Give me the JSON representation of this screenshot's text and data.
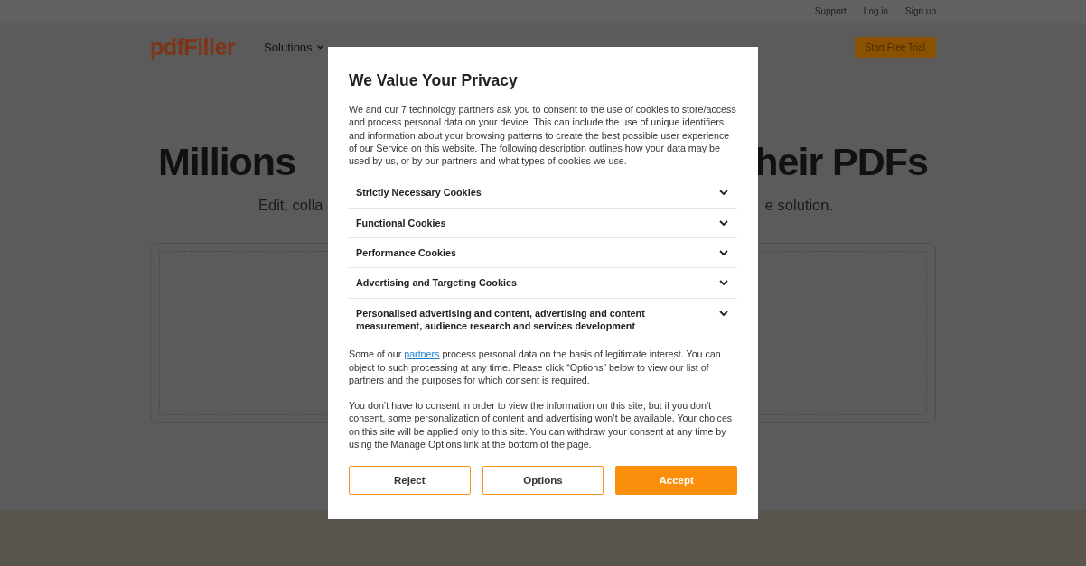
{
  "top_links": [
    "Support",
    "Log in",
    "Sign up"
  ],
  "logo": "pdfFiller",
  "nav": [
    {
      "label": "Solutions",
      "has_menu": true
    }
  ],
  "cta": "Start Free Trial",
  "hero": {
    "title_left": "Millions",
    "title_right": "heir PDFs",
    "subtitle_left": "Edit, colla",
    "subtitle_right": "e solution."
  },
  "dialog": {
    "title": "We Value Your Privacy",
    "intro": "We and our 7 technology partners ask you to consent to the use of cookies to store/access and process personal data on your device. This can include the use of unique identifiers and information about your browsing patterns to create the best possible user experience of our Service on this website. The following description outlines how your data may be used by us, or by our partners and what types of cookies we use.",
    "sections": [
      {
        "label": "Strictly Necessary Cookies",
        "expanded": false
      },
      {
        "label": "Functional Cookies",
        "expanded": false
      },
      {
        "label": "Performance Cookies",
        "expanded": false
      },
      {
        "label": "Advertising and Targeting Cookies",
        "expanded": false
      },
      {
        "label": "Personalised advertising and content, advertising and content measurement, audience research and services development",
        "expanded": false
      }
    ],
    "notice_before": "Some of our ",
    "notice_link": "partners",
    "notice_after": " process personal data on the basis of legitimate interest. You can object to such processing at any time. Please click “Options” below to view our list of partners and the purposes for which consent is required.",
    "footer_text": "You don’t have to consent in order to view the information on this site, but if you don’t consent, some personalization of content and advertising won’t be available. Your choices on this site will be applied only to this site. You can withdraw your consent at any time by using the Manage Options link at the bottom of the page.",
    "buttons": [
      {
        "label": "Reject",
        "kind": "outline"
      },
      {
        "label": "Options",
        "kind": "outline"
      },
      {
        "label": "Accept",
        "kind": "filled"
      }
    ]
  }
}
